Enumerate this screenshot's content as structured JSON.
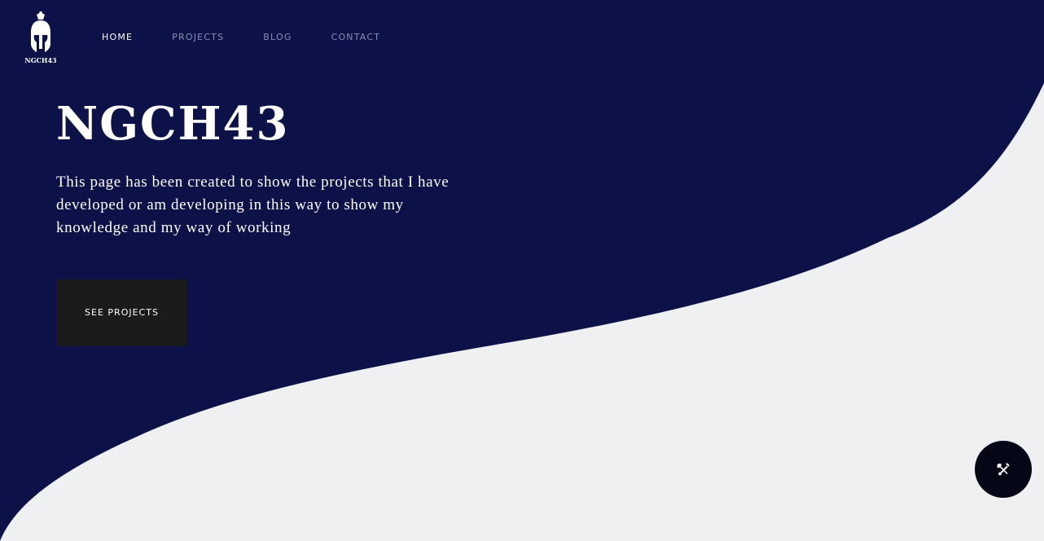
{
  "brand": {
    "logo_text": "NGCH43",
    "logo_icon": "spartan-helmet-icon"
  },
  "nav": {
    "items": [
      {
        "label": "HOME",
        "active": true
      },
      {
        "label": "PROJECTS",
        "active": false
      },
      {
        "label": "BLOG",
        "active": false
      },
      {
        "label": "CONTACT",
        "active": false
      }
    ]
  },
  "hero": {
    "title": "NGCH43",
    "description": "This page has been created to show the projects that I have developed or am developing in this way to show my knowledge and my way of working",
    "cta_label": "SEE PROJECTS"
  },
  "fab": {
    "icon": "tools-icon"
  },
  "colors": {
    "navy": "#0c1147",
    "light_bg": "#eff0f2",
    "button_dark": "#1b1b1c",
    "fab_bg": "#050717",
    "nav_inactive": "#8b8fb3"
  }
}
